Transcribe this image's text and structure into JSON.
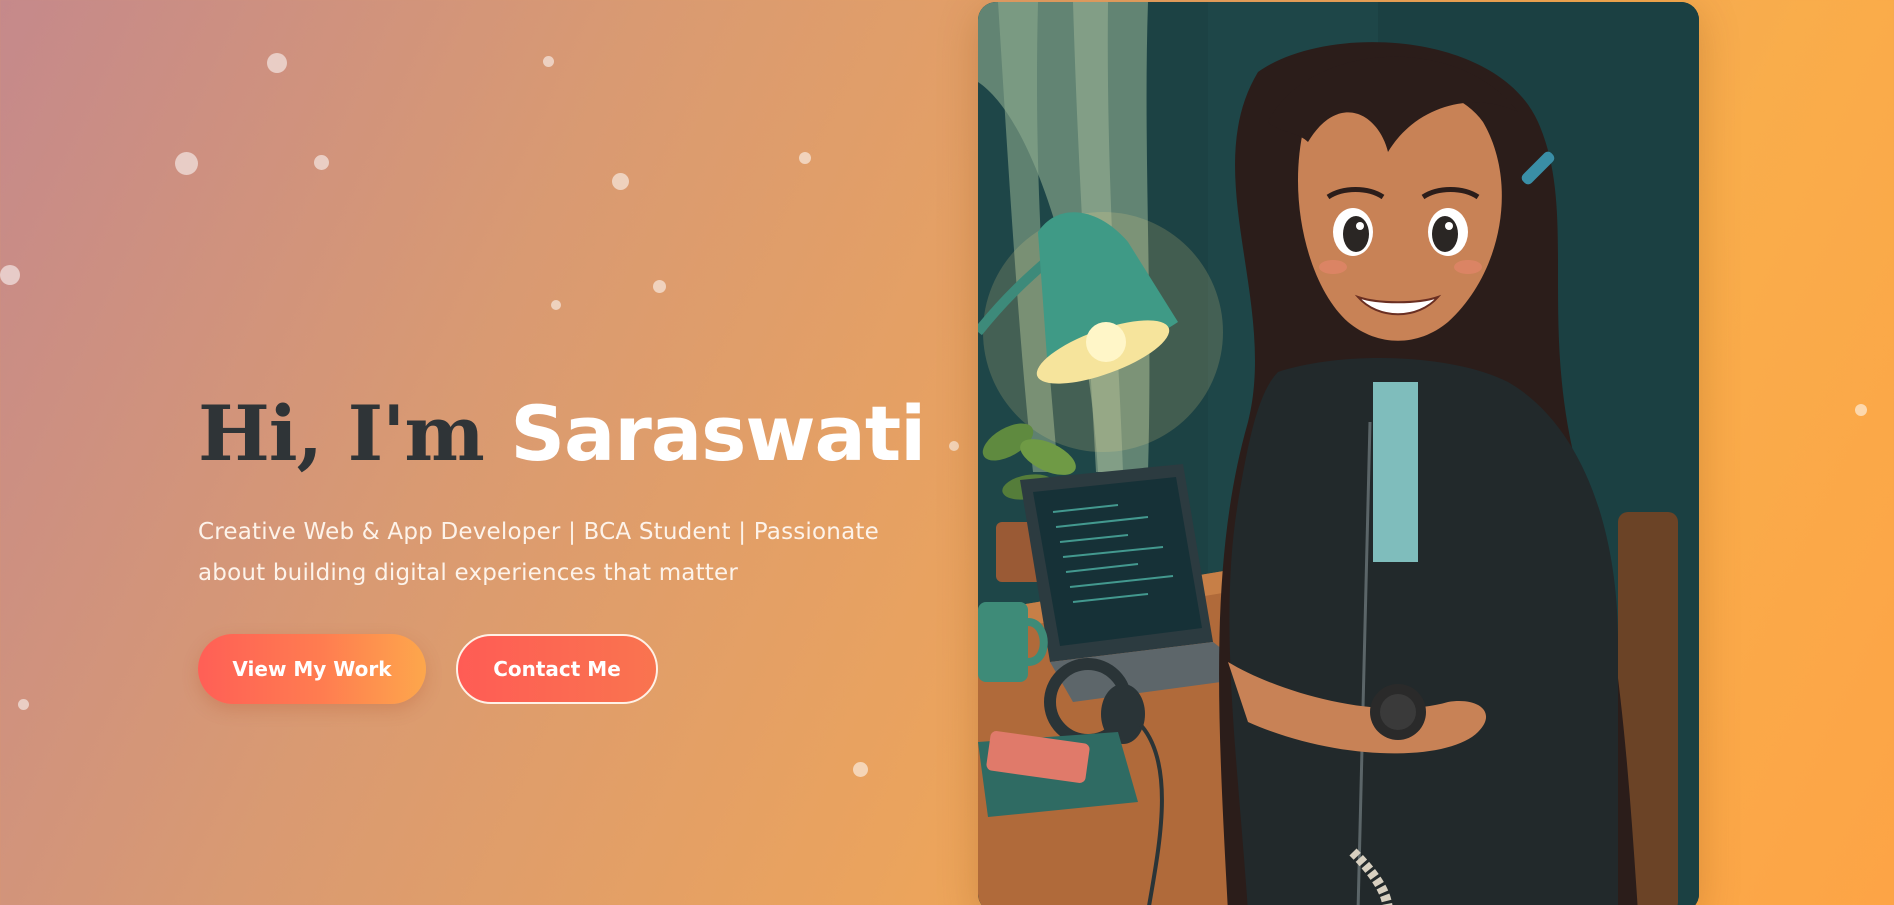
{
  "hero": {
    "greeting": "Hi, I'm",
    "name": "Saraswati",
    "tagline": "Creative Web & App Developer | BCA Student | Passionate about building digital experiences that matter",
    "primary_button": "View My Work",
    "secondary_button": "Contact Me"
  },
  "portrait": {
    "subject": "illustration of girl at desk with laptop, lamp, headphones and plant"
  },
  "colors": {
    "title_dark": "#2f3437",
    "accent_start": "#ff5f56",
    "accent_end": "#fda74c"
  }
}
